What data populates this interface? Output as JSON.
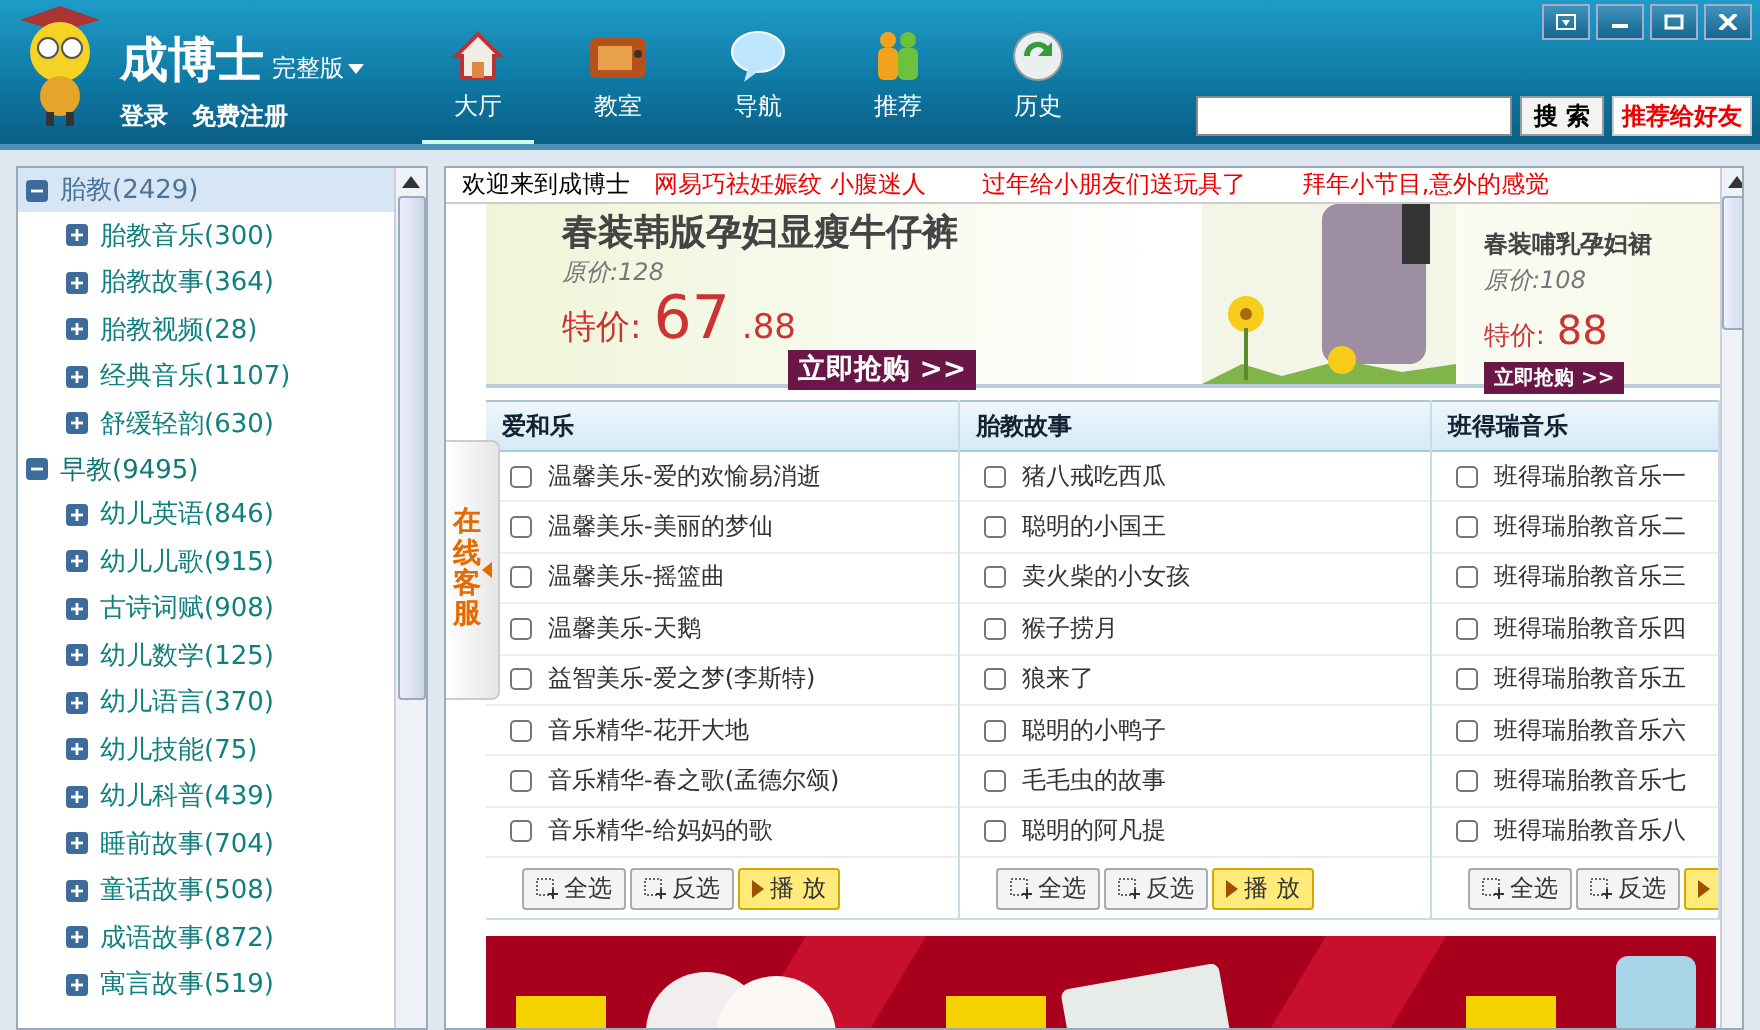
{
  "app": {
    "name": "成博士",
    "edition": "完整版",
    "links": [
      "登录",
      "免费注册"
    ]
  },
  "nav": [
    {
      "label": "大厅",
      "kind": "house",
      "selected": true
    },
    {
      "label": "教室",
      "kind": "tv",
      "selected": false
    },
    {
      "label": "导航",
      "kind": "bubble",
      "selected": false
    },
    {
      "label": "推荐",
      "kind": "people",
      "selected": false
    },
    {
      "label": "历史",
      "kind": "refresh",
      "selected": false
    }
  ],
  "search": {
    "button": "搜 索",
    "recommend": "推荐给好友"
  },
  "tree": [
    {
      "label": "胎教",
      "count": "(2429)",
      "selected": true,
      "expanded": true,
      "children": [
        {
          "label": "胎教音乐",
          "count": "(300)",
          "expanded": false
        },
        {
          "label": "胎教故事",
          "count": "(364)",
          "expanded": false
        },
        {
          "label": "胎教视频",
          "count": "(28)",
          "expanded": false
        },
        {
          "label": "经典音乐",
          "count": "(1107)",
          "expanded": false
        },
        {
          "label": "舒缓轻韵",
          "count": "(630)",
          "expanded": false
        }
      ]
    },
    {
      "label": "早教",
      "count": "(9495)",
      "selected": false,
      "expanded": true,
      "children": [
        {
          "label": "幼儿英语",
          "count": "(846)",
          "expanded": false
        },
        {
          "label": "幼儿儿歌",
          "count": "(915)",
          "expanded": false
        },
        {
          "label": "古诗词赋",
          "count": "(908)",
          "expanded": false
        },
        {
          "label": "幼儿数学",
          "count": "(125)",
          "expanded": false
        },
        {
          "label": "幼儿语言",
          "count": "(370)",
          "expanded": false
        },
        {
          "label": "幼儿技能",
          "count": "(75)",
          "expanded": false
        },
        {
          "label": "幼儿科普",
          "count": "(439)",
          "expanded": false
        },
        {
          "label": "睡前故事",
          "count": "(704)",
          "expanded": false
        },
        {
          "label": "童话故事",
          "count": "(508)",
          "expanded": false
        },
        {
          "label": "成语故事",
          "count": "(872)",
          "expanded": false
        },
        {
          "label": "寓言故事",
          "count": "(519)",
          "expanded": false
        }
      ]
    }
  ],
  "welcome": "欢迎来到成博士",
  "news": [
    "网易巧祛妊娠纹 小腹迷人",
    "过年给小朋友们送玩具了",
    "拜年小节目,意外的感觉"
  ],
  "promo": {
    "title": "春装韩版孕妇显瘦牛仔裤",
    "old_price": "原价:128",
    "price_label": "特价:",
    "price": "67",
    "cents": ".88",
    "buy": "立即抢购 >>",
    "side_title": "春装哺乳孕妇裙",
    "side_old": "原价:108",
    "side_price_label": "特价:",
    "side_price": "88",
    "side_buy": "立即抢购 >>"
  },
  "service_tab": "在线客服",
  "playlists": [
    {
      "title": "爱和乐",
      "items": [
        {
          "label": "温馨美乐-爱的欢愉易消逝",
          "checked": false
        },
        {
          "label": "温馨美乐-美丽的梦仙",
          "checked": false
        },
        {
          "label": "温馨美乐-摇篮曲",
          "checked": false
        },
        {
          "label": "温馨美乐-天鹅",
          "checked": false
        },
        {
          "label": "益智美乐-爱之梦(李斯特)",
          "checked": false
        },
        {
          "label": "音乐精华-花开大地",
          "checked": false
        },
        {
          "label": "音乐精华-春之歌(孟德尔颂)",
          "checked": false
        },
        {
          "label": "音乐精华-给妈妈的歌",
          "checked": false
        }
      ],
      "buttons": [
        {
          "kind": "select",
          "label": "全选"
        },
        {
          "kind": "select",
          "label": "反选"
        },
        {
          "kind": "play",
          "label": "播 放"
        }
      ]
    },
    {
      "title": "胎教故事",
      "items": [
        {
          "label": "猪八戒吃西瓜",
          "checked": false
        },
        {
          "label": "聪明的小国王",
          "checked": false
        },
        {
          "label": "卖火柴的小女孩",
          "checked": false
        },
        {
          "label": "猴子捞月",
          "checked": false
        },
        {
          "label": "狼来了",
          "checked": false
        },
        {
          "label": "聪明的小鸭子",
          "checked": false
        },
        {
          "label": "毛毛虫的故事",
          "checked": false
        },
        {
          "label": "聪明的阿凡提",
          "checked": false
        }
      ],
      "buttons": [
        {
          "kind": "select",
          "label": "全选"
        },
        {
          "kind": "select",
          "label": "反选"
        },
        {
          "kind": "play",
          "label": "播 放"
        }
      ]
    },
    {
      "title": "班得瑞音乐",
      "items": [
        {
          "label": "班得瑞胎教音乐一",
          "checked": false
        },
        {
          "label": "班得瑞胎教音乐二",
          "checked": false
        },
        {
          "label": "班得瑞胎教音乐三",
          "checked": false
        },
        {
          "label": "班得瑞胎教音乐四",
          "checked": false
        },
        {
          "label": "班得瑞胎教音乐五",
          "checked": false
        },
        {
          "label": "班得瑞胎教音乐六",
          "checked": false
        },
        {
          "label": "班得瑞胎教音乐七",
          "checked": false
        },
        {
          "label": "班得瑞胎教音乐八",
          "checked": false
        }
      ],
      "buttons": [
        {
          "kind": "select",
          "label": "全选"
        },
        {
          "kind": "select",
          "label": "反选"
        },
        {
          "kind": "play"
        }
      ]
    }
  ]
}
